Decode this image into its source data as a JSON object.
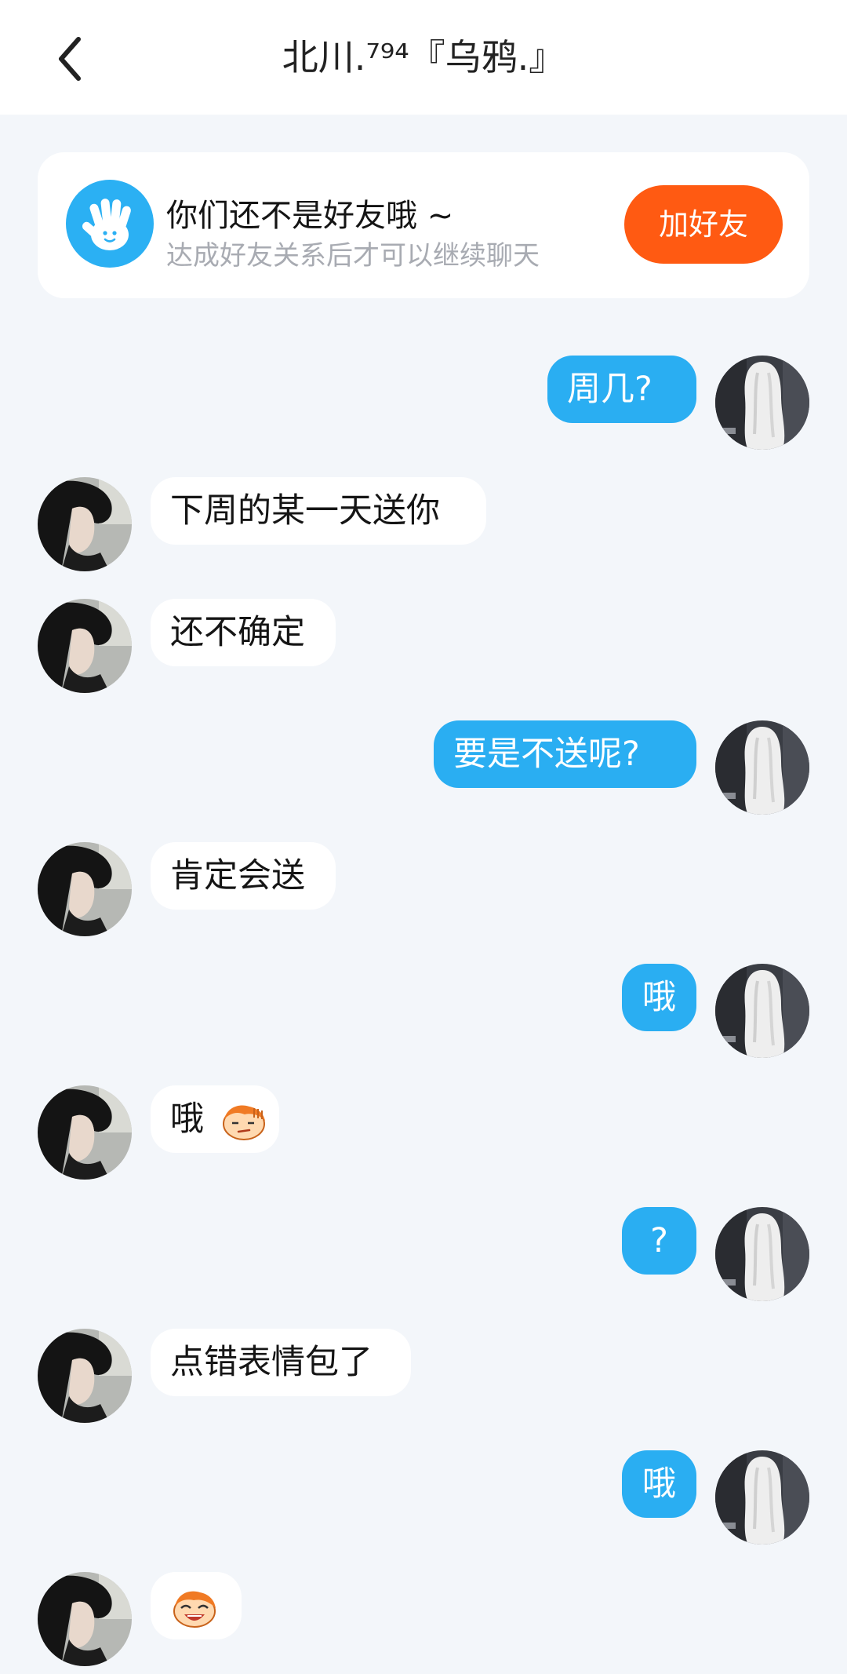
{
  "header": {
    "back_icon": "chevron-left-icon",
    "title": "北川.⁷⁹⁴『乌鸦.』"
  },
  "notice": {
    "icon": "waving-hand-icon",
    "title": "你们还不是好友哦 ~",
    "subtitle": "达成好友关系后才可以继续聊天",
    "button_label": "加好友",
    "accent": "#ff5a12",
    "icon_bg": "#2bb0f3"
  },
  "messages": [
    {
      "side": "me",
      "text": "周几?"
    },
    {
      "side": "them",
      "text": "下周的某一天送你"
    },
    {
      "side": "them",
      "text": "还不确定"
    },
    {
      "side": "me",
      "text": "要是不送呢?"
    },
    {
      "side": "them",
      "text": "肯定会送"
    },
    {
      "side": "me",
      "text": "哦"
    },
    {
      "side": "them",
      "text": "哦",
      "emoji": "smirk-emoji-icon"
    },
    {
      "side": "me",
      "text": "?"
    },
    {
      "side": "them",
      "text": "点错表情包了"
    },
    {
      "side": "me",
      "text": "哦"
    },
    {
      "side": "them",
      "text": "",
      "emoji": "laugh-emoji-icon"
    }
  ],
  "colors": {
    "my_bubble": "#2aaef2",
    "their_bubble": "#ffffff",
    "background": "#f3f6fa"
  }
}
